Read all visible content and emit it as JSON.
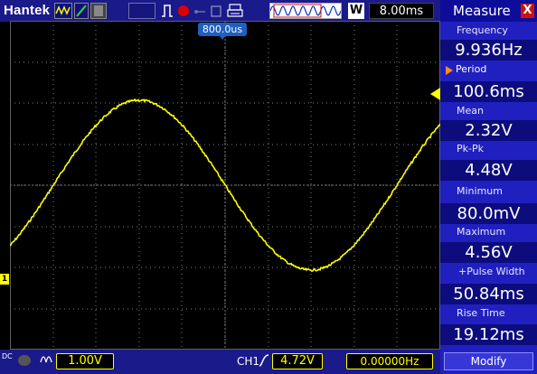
{
  "app": {
    "brand": "Hantek"
  },
  "topbar": {
    "timebase": "8.00ms",
    "window_badge": "W",
    "icons": [
      "waveform-icon",
      "cursor-icon",
      "math-icon",
      "run-stop-icon",
      "record-icon",
      "usb-icon",
      "save-icon",
      "print-icon"
    ]
  },
  "screen": {
    "trigger_position": "800.0us",
    "channel_marker": "1",
    "trace_color": "#ffff00",
    "grid_color": "#808080"
  },
  "measure": {
    "title": "Measure",
    "close": "X",
    "items": [
      {
        "label": "Frequency",
        "value": "9.936Hz"
      },
      {
        "label": "Period",
        "value": "100.6ms"
      },
      {
        "label": "Mean",
        "value": "2.32V"
      },
      {
        "label": "Pk-Pk",
        "value": "4.48V"
      },
      {
        "label": "Minimum",
        "value": "80.0mV"
      },
      {
        "label": "Maximum",
        "value": "4.56V"
      },
      {
        "label": "+Pulse Width",
        "value": "50.84ms"
      },
      {
        "label": "Rise Time",
        "value": "19.12ms"
      }
    ],
    "modify": "Modify",
    "accent": "#2020c0"
  },
  "bottombar": {
    "coupling": "DC",
    "ch1_scale": "1.00V",
    "trigger_source": "CH1",
    "trigger_level": "4.72V",
    "frequency_counter": "0.00000Hz"
  }
}
